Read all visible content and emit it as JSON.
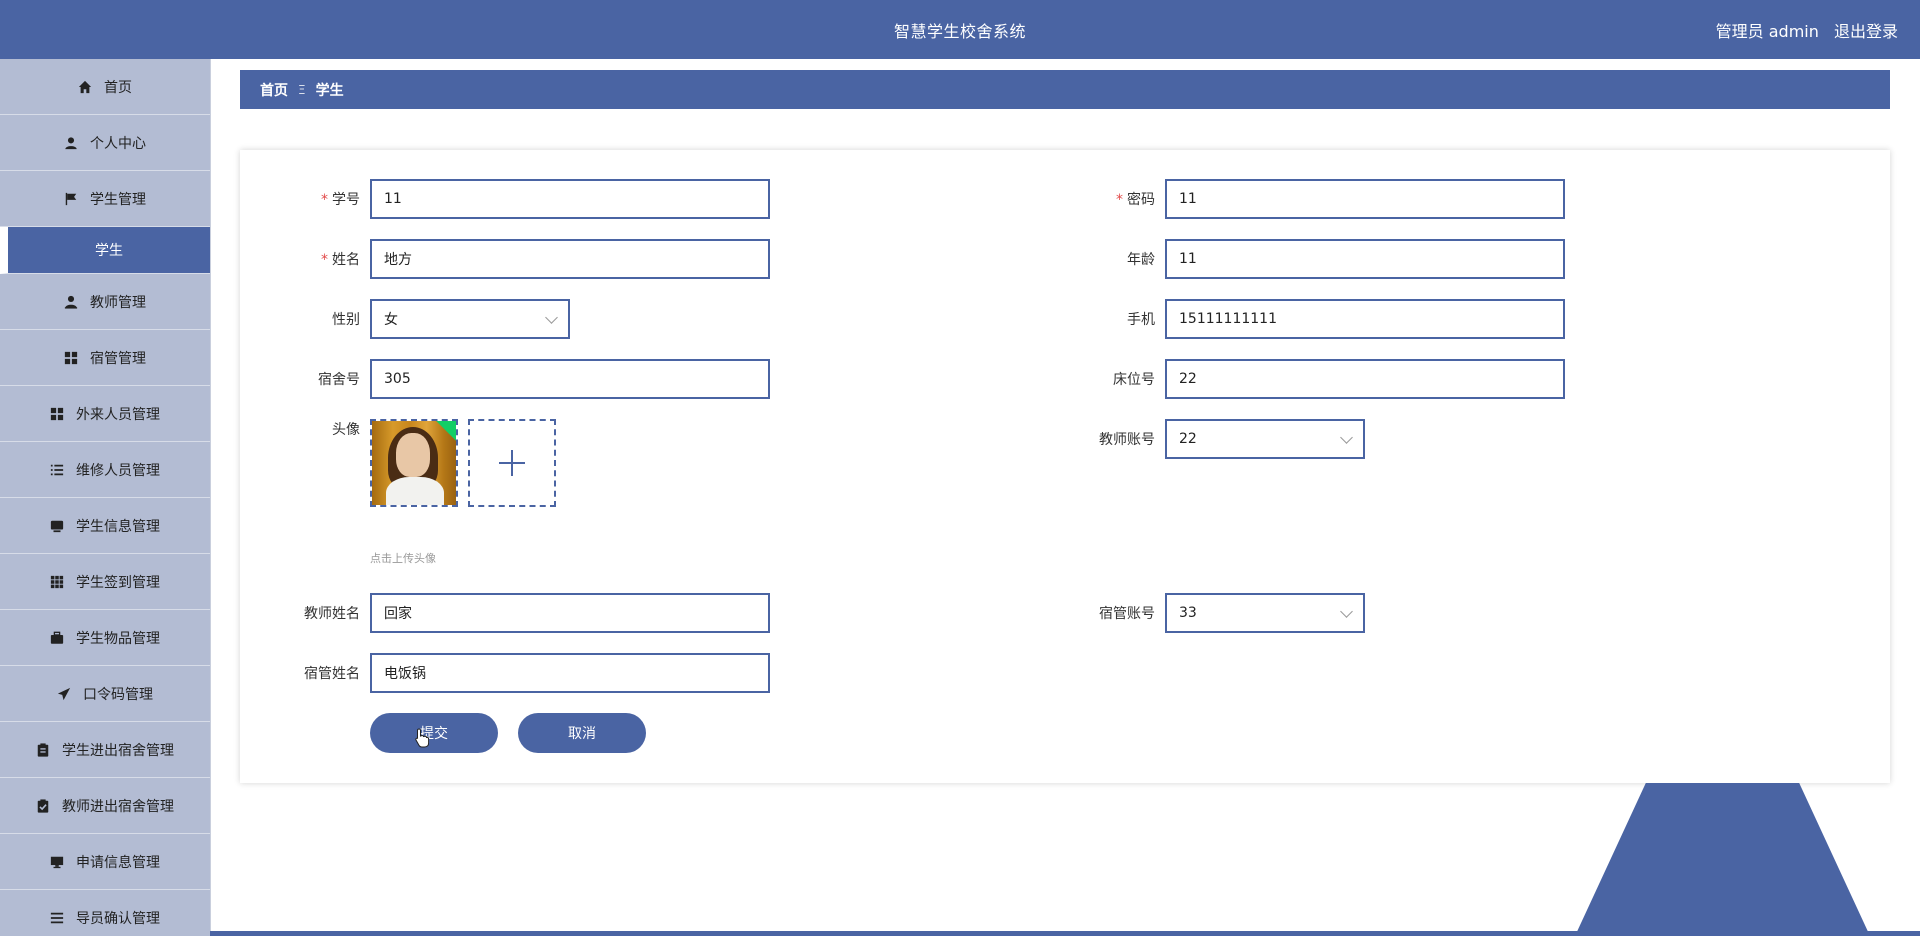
{
  "header": {
    "title": "智慧学生校舍系统",
    "role": "管理员 admin",
    "logout": "退出登录"
  },
  "sidebar": {
    "items": [
      {
        "label": "首页",
        "icon": "home-icon"
      },
      {
        "label": "个人中心",
        "icon": "user-icon"
      },
      {
        "label": "学生管理",
        "icon": "flag-icon"
      },
      {
        "label": "学生",
        "icon": "none",
        "active": true
      },
      {
        "label": "教师管理",
        "icon": "teacher-icon"
      },
      {
        "label": "宿管管理",
        "icon": "grid-icon"
      },
      {
        "label": "外来人员管理",
        "icon": "grid-icon"
      },
      {
        "label": "维修人员管理",
        "icon": "list-icon"
      },
      {
        "label": "学生信息管理",
        "icon": "inbox-icon"
      },
      {
        "label": "学生签到管理",
        "icon": "apps-icon"
      },
      {
        "label": "学生物品管理",
        "icon": "briefcase-icon"
      },
      {
        "label": "口令码管理",
        "icon": "send-icon"
      },
      {
        "label": "学生进出宿舍管理",
        "icon": "clipboard-icon"
      },
      {
        "label": "教师进出宿舍管理",
        "icon": "clipboard-check-icon"
      },
      {
        "label": "申请信息管理",
        "icon": "monitor-icon"
      },
      {
        "label": "导员确认管理",
        "icon": "menu-icon"
      }
    ]
  },
  "breadcrumb": {
    "home": "首页",
    "sep": "Ξ",
    "current": "学生"
  },
  "form": {
    "student_id": {
      "label": "学号",
      "value": "11"
    },
    "password": {
      "label": "密码",
      "value": "11"
    },
    "name": {
      "label": "姓名",
      "value": "地方"
    },
    "age": {
      "label": "年龄",
      "value": "11"
    },
    "gender": {
      "label": "性别",
      "value": "女"
    },
    "phone": {
      "label": "手机",
      "value": "15111111111"
    },
    "dorm": {
      "label": "宿舍号",
      "value": "305"
    },
    "bed": {
      "label": "床位号",
      "value": "22"
    },
    "avatar": {
      "label": "头像",
      "hint": "点击上传头像"
    },
    "teacher_account": {
      "label": "教师账号",
      "value": "22"
    },
    "teacher_name": {
      "label": "教师姓名",
      "value": "回家"
    },
    "manager_account": {
      "label": "宿管账号",
      "value": "33"
    },
    "manager_name": {
      "label": "宿管姓名",
      "value": "电饭锅"
    },
    "submit": "提交",
    "cancel": "取消"
  },
  "colors": {
    "primary": "#4a64a3",
    "sidebar_bg": "#b3bcd3",
    "required": "#e24a4a",
    "upload_badge": "#13ce66"
  }
}
